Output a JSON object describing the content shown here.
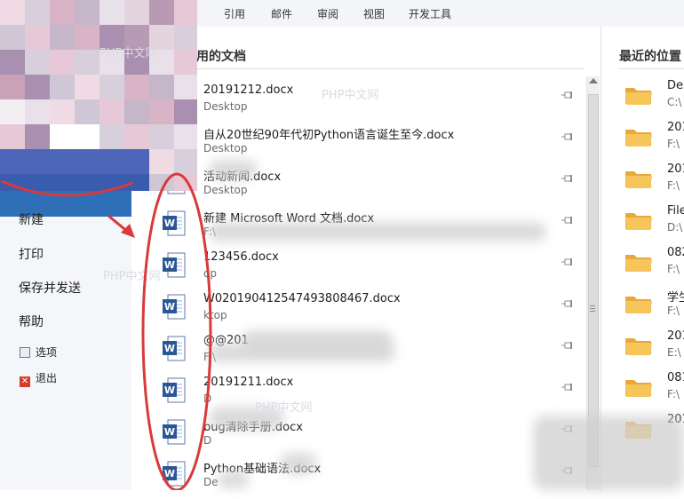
{
  "ribbon": {
    "tabs": [
      {
        "label": "引用"
      },
      {
        "label": "邮件"
      },
      {
        "label": "审阅"
      },
      {
        "label": "视图"
      },
      {
        "label": "开发工具"
      }
    ]
  },
  "menu": {
    "new": "新建",
    "print": "打印",
    "save_send": "保存并发送",
    "help": "帮助",
    "options": "选项",
    "exit": "退出"
  },
  "recent_docs": {
    "title": "用的文档",
    "items": [
      {
        "name": "20191212.docx",
        "path": "Desktop"
      },
      {
        "name": "自从20世纪90年代初Python语言诞生至今.docx",
        "path": "Desktop"
      },
      {
        "name": "活动新闻.docx",
        "path": "Desktop"
      },
      {
        "name": "新建 Microsoft Word 文档.docx",
        "path": "F:\\"
      },
      {
        "name": "123456.docx",
        "path": "op"
      },
      {
        "name": "W020190412547493808467.docx",
        "path": "ktop"
      },
      {
        "name": "@@201",
        "path": "F:\\"
      },
      {
        "name": "20191211.docx",
        "path": "D"
      },
      {
        "name": "bug清除手册.docx",
        "path": "D"
      },
      {
        "name": "Python基础语法.docx",
        "path": "De"
      }
    ]
  },
  "recent_places": {
    "title": "最近的位置",
    "items": [
      {
        "name": "Des",
        "path": "C:\\"
      },
      {
        "name": "201",
        "path": "F:\\"
      },
      {
        "name": "201",
        "path": "F:\\"
      },
      {
        "name": "File",
        "path": "D:\\"
      },
      {
        "name": "082",
        "path": "F:\\"
      },
      {
        "name": "学生",
        "path": "F:\\"
      },
      {
        "name": "201",
        "path": "E:\\"
      },
      {
        "name": "081",
        "path": "F:\\"
      },
      {
        "name": "201",
        "path": ""
      }
    ]
  },
  "watermarks": [
    "PHP中文网",
    "PHP中文网",
    "PHP中文网",
    "PHP中文网"
  ],
  "colors": {
    "accent_blue": "#2f6fb7",
    "annotation_red": "#d93a3a",
    "folder": "#f2b740",
    "word_blue": "#2b5797"
  },
  "icons": {
    "document": "word-document-icon",
    "pin": "pin-icon",
    "folder": "folder-icon",
    "options": "options-icon",
    "exit": "exit-icon"
  }
}
